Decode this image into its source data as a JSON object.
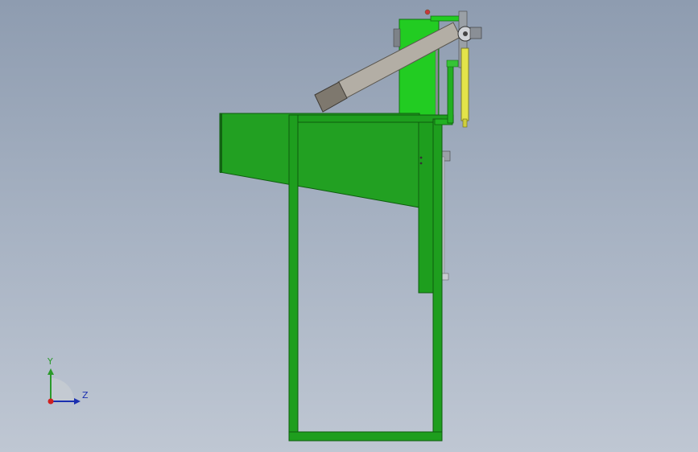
{
  "window": {
    "title": ""
  },
  "viewport": {
    "background_top": "#8e9cb0",
    "background_bottom": "#bfc7d3",
    "model": {
      "frame_color": "#1e9e1e",
      "frame_highlight": "#36c436",
      "hopper_color": "#22a022",
      "chute_color": "#b3aea5",
      "chute_end_color": "#7e786e",
      "column_color": "#22cc22",
      "yellow_part_color": "#e3e34a",
      "metal_gray": "#8a8f96"
    }
  },
  "triad": {
    "y_label": "Y",
    "z_label": "Z",
    "y_color": "#2a9a2a",
    "z_color": "#1a2fb0",
    "x_color": "#d02020"
  }
}
